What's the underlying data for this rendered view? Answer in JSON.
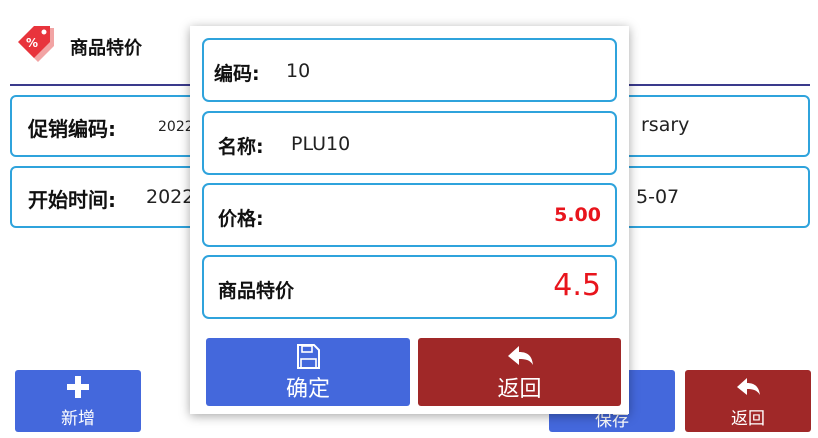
{
  "header": {
    "title": "商品特价",
    "logo_icon": "price-tag-icon",
    "logo_symbol": "%"
  },
  "background_form": {
    "promo_code_label": "促销编码:",
    "promo_code_value": "20220",
    "promo_name_value_fragment": "rsary",
    "start_time_label": "开始时间:",
    "start_time_value": "2022",
    "end_time_value_fragment": "5-07"
  },
  "background_buttons": {
    "add_label": "新增",
    "save_label": "保存",
    "back_label": "返回"
  },
  "dialog": {
    "code_label": "编码:",
    "code_value": "10",
    "name_label": "名称:",
    "name_value": "PLU10",
    "price_label": "价格:",
    "price_value": "5.00",
    "special_price_label": "商品特价",
    "special_price_value": "4.5",
    "confirm_label": "确定",
    "back_label": "返回"
  },
  "colors": {
    "field_border": "#2fa3dc",
    "button_blue": "#4468dc",
    "button_red": "#a02828",
    "price_red": "#e8141c"
  }
}
